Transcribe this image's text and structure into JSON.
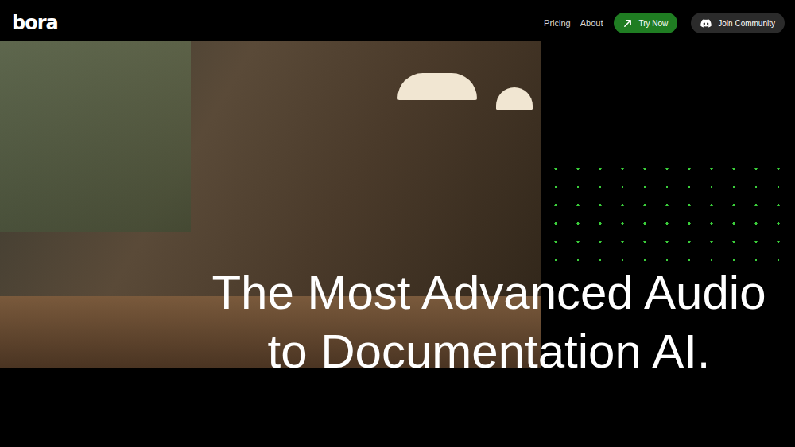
{
  "header": {
    "logo": "bora",
    "nav": [
      {
        "label": "Pricing"
      },
      {
        "label": "About"
      }
    ],
    "try_button": {
      "label": "Try Now"
    },
    "community_button": {
      "label": "Join Community"
    }
  },
  "hero": {
    "headline_lines": [
      "The Most Advanced Audio",
      "to Documentation AI."
    ]
  }
}
